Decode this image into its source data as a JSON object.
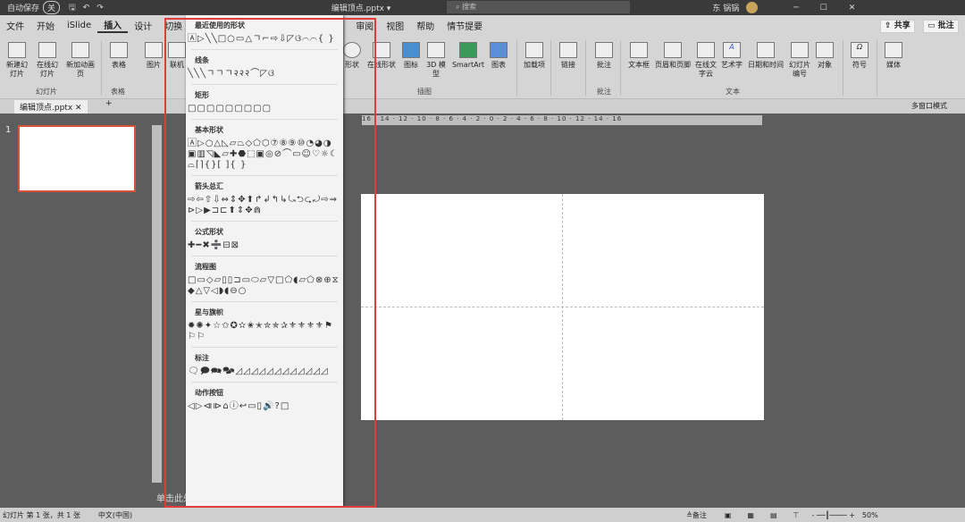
{
  "titlebar": {
    "autosave": "自动保存",
    "autosave_state": "关",
    "filename": "编辑顶点.pptx ▾",
    "search_placeholder": "搜索",
    "user": "东 锅锅"
  },
  "tabs": [
    "文件",
    "开始",
    "iSlide",
    "插入",
    "设计",
    "切换",
    "审阅",
    "视图",
    "帮助",
    "情节提要"
  ],
  "ribbon": {
    "new_slide": "新建幻灯片",
    "online_slide": "在线幻灯片",
    "add_anim": "新加动画页",
    "table": "表格",
    "picture": "图片",
    "online": "联机",
    "shapes": "形状",
    "online_shapes": "在线形状",
    "icons": "图标",
    "model3d": "3D 模型",
    "smartart": "SmartArt",
    "chart": "图表",
    "addins": "加载项",
    "link": "链接",
    "comment": "批注",
    "textbox": "文本框",
    "header_footer": "页眉和页脚",
    "wordcloud": "在线文字云",
    "wordart": "艺术字",
    "datetime": "日期和时间",
    "slide_number": "幻灯片编号",
    "object": "对象",
    "symbol": "符号",
    "media": "媒体",
    "groups": {
      "slides": "幻灯片",
      "tables": "表格",
      "illustrations": "插图",
      "comments": "批注",
      "text": "文本"
    },
    "share": "共享",
    "comments_btn": "批注"
  },
  "doctab": {
    "name": "编辑顶点.pptx",
    "multiwindow": "多窗口模式"
  },
  "ruler": "16 · 14 · 12 · 10 · 8 · 6 · 4 · 2 · 0 · 2 · 4 · 6 · 8 · 10 · 12 · 14 · 16",
  "slide_number": "1",
  "notes_placeholder": "单击此处添加备注",
  "shapes_menu": [
    {
      "title": "最近使用的形状",
      "glyphs": "🄰▷╲╲□○▭△ㄱ⌐⇨⇩◸ଓ⌒⌒{ }"
    },
    {
      "title": "线条",
      "glyphs": "╲╲╲ㄱㄱㄱ२२२⌒◸ଓ"
    },
    {
      "title": "矩形",
      "glyphs": "□▢▢▢▢▢▢▢▢"
    },
    {
      "title": "基本形状",
      "glyphs": "🄰▷○△◺▱⏢◇⬠⬡⑦⑧⑨⑩◔◕◑▣▥◹◣▱✚⬣⬚▣◎⊘⌒▭☺♡☼☾⌓⌈⌉{}[ ]{ }"
    },
    {
      "title": "箭头总汇",
      "glyphs": "⇨⇦⇧⇩⇔⇕✥⬆↱↲↰↳⤿⮌⮎⤾⇨⇒⊳▷▶⊐⊏⬆⇕✥⋒"
    },
    {
      "title": "公式形状",
      "glyphs": "✚━✖➗⊟⊠"
    },
    {
      "title": "流程图",
      "glyphs": "□▭◇▱▯▯⊐▭⬭▱▽□⬠◖▱⬠⊗⊕⧖◆△▽◁◗◖⊖○"
    },
    {
      "title": "星与旗帜",
      "glyphs": "✹✺✦☆✩✪✫✬✭✮✯✰⚜⚜⚜⚜⚑⚐⚐"
    },
    {
      "title": "标注",
      "glyphs": "🗨🗩🗪🗫◿◿◿◿◿◿◿◿◿◿◿◿"
    },
    {
      "title": "动作按钮",
      "glyphs": "◁▷⧏⧐⌂ⓘ↩▭▯🔊?□"
    }
  ],
  "status": {
    "slide_info": "幻灯片 第 1 张，共 1 张",
    "language": "中文(中国)",
    "notes": "备注",
    "zoom": "50%"
  },
  "colors": {
    "highlight": "#e03c3c",
    "selected_thumb": "#d6523b"
  }
}
